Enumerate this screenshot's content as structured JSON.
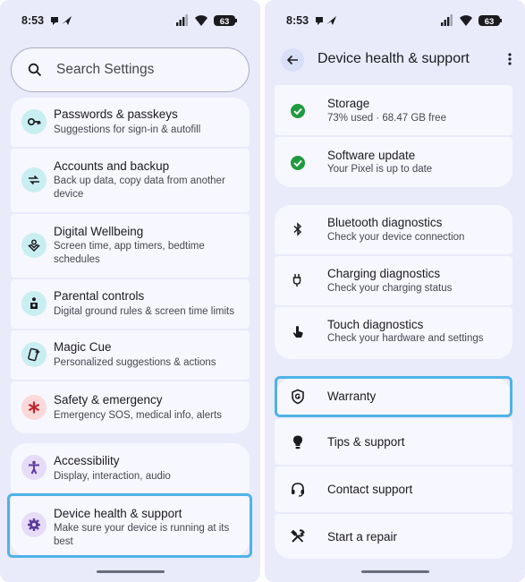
{
  "status": {
    "time": "8:53",
    "battery": "63"
  },
  "left": {
    "search": {
      "placeholder": "Search Settings"
    },
    "items": [
      {
        "title": "Passwords & passkeys",
        "subtitle": "Suggestions for sign-in & autofill",
        "icon": "key-icon",
        "color": "#c9eef2"
      },
      {
        "title": "Accounts and backup",
        "subtitle": "Back up data, copy data from another device",
        "icon": "sync-icon",
        "color": "#c9eef2"
      },
      {
        "title": "Digital Wellbeing",
        "subtitle": "Screen time, app timers, bedtime schedules",
        "icon": "wellbeing-icon",
        "color": "#c9eef2"
      },
      {
        "title": "Parental controls",
        "subtitle": "Digital ground rules & screen time limits",
        "icon": "parental-icon",
        "color": "#c9eef2"
      },
      {
        "title": "Magic Cue",
        "subtitle": "Personalized suggestions & actions",
        "icon": "magic-cue-icon",
        "color": "#c9eef2"
      },
      {
        "title": "Safety & emergency",
        "subtitle": "Emergency SOS, medical info, alerts",
        "icon": "asterisk-icon",
        "color": "#fbd9d9"
      },
      {
        "title": "Accessibility",
        "subtitle": "Display, interaction, audio",
        "icon": "accessibility-icon",
        "color": "#e7dcf7"
      },
      {
        "title": "Device health & support",
        "subtitle": "Make sure your device is running at its best",
        "icon": "gear-icon",
        "color": "#e7dcf7"
      }
    ]
  },
  "right": {
    "title": "Device health & support",
    "status_items": [
      {
        "title": "Storage",
        "subtitle": "73% used · 68.47 GB free"
      },
      {
        "title": "Software update",
        "subtitle": "Your Pixel is up to date"
      }
    ],
    "diagnostics": [
      {
        "title": "Bluetooth diagnostics",
        "subtitle": "Check your device connection",
        "icon": "bluetooth-icon"
      },
      {
        "title": "Charging diagnostics",
        "subtitle": "Check your charging status",
        "icon": "charging-icon"
      },
      {
        "title": "Touch diagnostics",
        "subtitle": "Check your hardware and settings",
        "icon": "touch-icon"
      }
    ],
    "support": [
      {
        "title": "Warranty",
        "icon": "warranty-shield-icon"
      },
      {
        "title": "Tips & support",
        "icon": "lightbulb-icon"
      },
      {
        "title": "Contact support",
        "icon": "headset-icon"
      },
      {
        "title": "Start a repair",
        "icon": "tools-icon"
      }
    ],
    "colors": {
      "check": "#1e9a3f",
      "highlight": "#4fb3e6"
    }
  }
}
